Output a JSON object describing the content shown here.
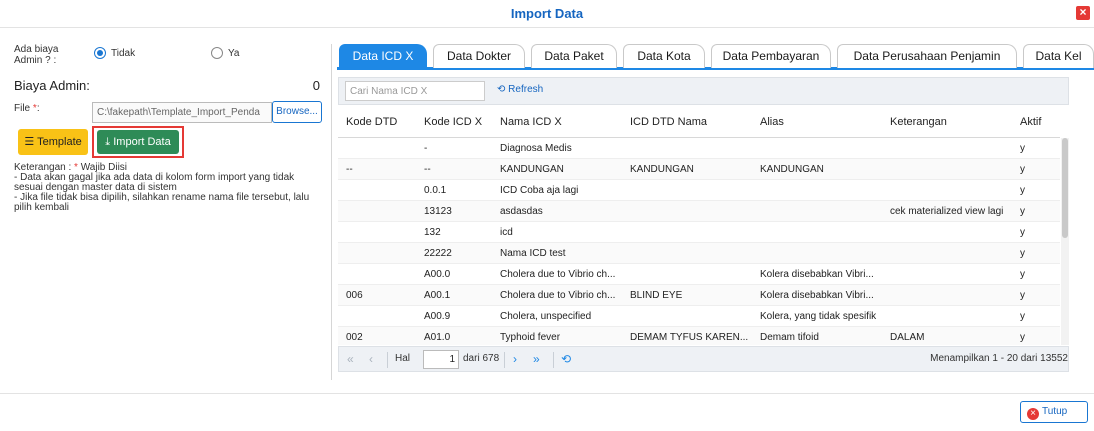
{
  "dialog": {
    "title": "Import Data"
  },
  "form": {
    "biaya_question": "Ada biaya",
    "biaya_question2": "Admin ? :",
    "radio_tidak": "Tidak",
    "radio_ya": "Ya",
    "biaya_admin_label": "Biaya Admin:",
    "biaya_admin_value": "0",
    "file_label": "File ",
    "file_required": "*",
    "file_colon": ":",
    "file_path": "C:\\fakepath\\Template_Import_Penda",
    "browse_label": "Browse...",
    "template_label": "Template",
    "import_label": "Import Data",
    "note_prefix": "Keterangan : ",
    "note_req_star": "*",
    "note_req_text": " Wajib Diisi",
    "note_line1": "- Data akan gagal jika ada data di kolom form import yang tidak sesuai dengan master data di sistem",
    "note_line2": "- Jika file tidak bisa dipilih, silahkan rename nama file tersebut, lalu pilih kembali"
  },
  "tabs": [
    {
      "label": "Data ICD X",
      "active": true
    },
    {
      "label": "Data Dokter"
    },
    {
      "label": "Data Paket"
    },
    {
      "label": "Data Kota"
    },
    {
      "label": "Data Pembayaran"
    },
    {
      "label": "Data Perusahaan Penjamin"
    },
    {
      "label": "Data Kel"
    }
  ],
  "toolbar": {
    "search_placeholder": "Cari Nama ICD X",
    "refresh_label": "Refresh"
  },
  "grid": {
    "columns": [
      "Kode DTD",
      "Kode ICD X",
      "Nama ICD X",
      "ICD DTD Nama",
      "Alias",
      "Keterangan",
      "Aktif"
    ],
    "rows": [
      [
        "",
        "-",
        "Diagnosa Medis",
        "",
        "",
        "",
        "y"
      ],
      [
        "--",
        "--",
        "KANDUNGAN",
        "KANDUNGAN",
        "KANDUNGAN",
        "",
        "y"
      ],
      [
        "",
        "0.0.1",
        "ICD Coba aja lagi",
        "",
        "",
        "",
        "y"
      ],
      [
        "",
        "13123",
        "asdasdas",
        "",
        "",
        "cek materialized view lagi",
        "y"
      ],
      [
        "",
        "132",
        "icd",
        "",
        "",
        "",
        "y"
      ],
      [
        "",
        "22222",
        "Nama ICD test",
        "",
        "",
        "",
        "y"
      ],
      [
        "",
        "A00.0",
        "Cholera due to Vibrio ch...",
        "",
        "Kolera disebabkan Vibri...",
        "",
        "y"
      ],
      [
        "006",
        "A00.1",
        "Cholera due to Vibrio ch...",
        "BLIND EYE",
        "Kolera disebabkan Vibri...",
        "",
        "y"
      ],
      [
        "",
        "A00.9",
        "Cholera, unspecified",
        "",
        "Kolera, yang tidak spesifik",
        "",
        "y"
      ],
      [
        "002",
        "A01.0",
        "Typhoid fever",
        "DEMAM TYFUS KAREN...",
        "Demam tifoid",
        "DALAM",
        "y"
      ]
    ]
  },
  "pager": {
    "hal_label": "Hal",
    "page": "1",
    "of_label": "dari 678",
    "summary": "Menampilkan 1 - 20 dari 13552"
  },
  "footer": {
    "close_label": "Tutup"
  },
  "colors": {
    "accent": "#1e88e5",
    "import_btn": "#2e8b57",
    "template_btn": "#f9c216",
    "danger": "#e53935"
  }
}
